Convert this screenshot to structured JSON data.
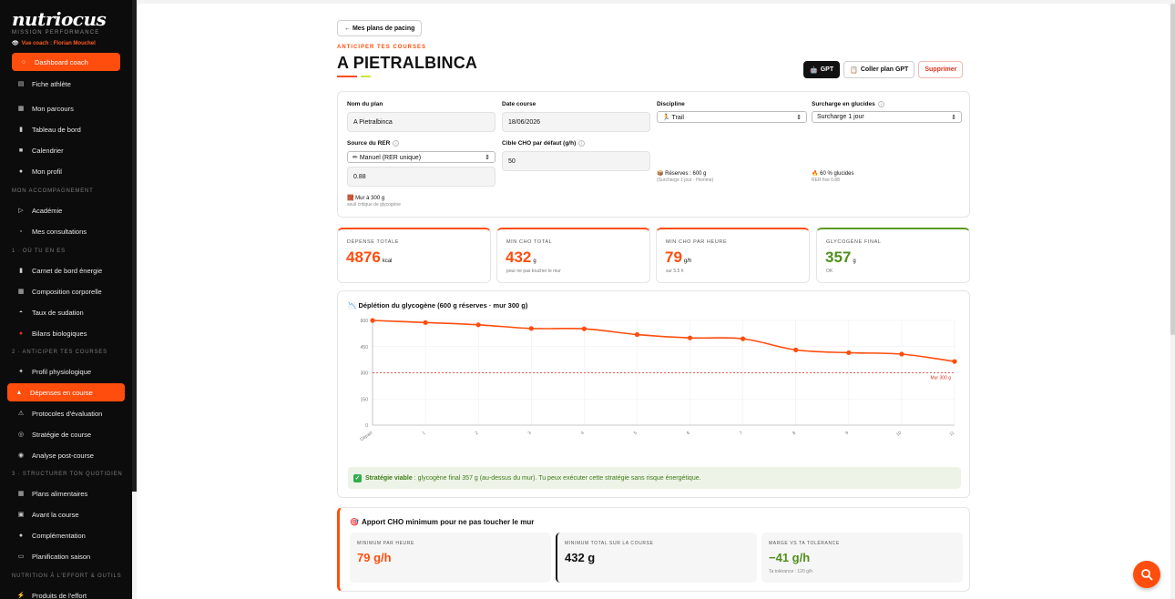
{
  "sidebar": {
    "logo": "nutriocus",
    "subtitle": "MISSION PERFORMANCE",
    "coach_line": "Vue coach : Florian Mouchel",
    "top_items": [
      {
        "label": "Dashboard coach",
        "icon": "dashboard-icon",
        "active": true
      },
      {
        "label": "Fiche athlète",
        "icon": "clipboard-icon",
        "active": false
      },
      {
        "label": "Mon parcours",
        "icon": "map-icon",
        "active": false
      },
      {
        "label": "Tableau de bord",
        "icon": "chart-icon",
        "active": false
      },
      {
        "label": "Calendrier",
        "icon": "calendar-icon",
        "active": false
      },
      {
        "label": "Mon profil",
        "icon": "user-icon",
        "active": false
      }
    ],
    "section_accompagnement": "MON ACCOMPAGNEMENT",
    "accompagnement_items": [
      {
        "label": "Académie",
        "icon": "play-icon"
      },
      {
        "label": "Mes consultations",
        "icon": "calendar-icon"
      }
    ],
    "section_1": "1 · OÙ TU EN ES",
    "section_1_items": [
      {
        "label": "Carnet de bord énergie",
        "icon": "bar-icon"
      },
      {
        "label": "Composition corporelle",
        "icon": "grid-icon"
      },
      {
        "label": "Taux de sudation",
        "icon": "drop-icon"
      },
      {
        "label": "Bilans biologiques",
        "icon": "blood-icon"
      }
    ],
    "section_2": "2 · ANTICIPER TES COURSES",
    "section_2_items": [
      {
        "label": "Profil physiologique",
        "icon": "pulse-icon",
        "active": false
      },
      {
        "label": "Dépenses en course",
        "icon": "flame-icon",
        "active": true
      },
      {
        "label": "Protocoles d'évaluation",
        "icon": "flask-icon",
        "active": false
      },
      {
        "label": "Stratégie de course",
        "icon": "target-icon",
        "active": false
      },
      {
        "label": "Analyse post-course",
        "icon": "analysis-icon",
        "active": false
      }
    ],
    "section_3": "3 · STRUCTURER TON QUOTIDIEN",
    "section_3_items": [
      {
        "label": "Plans alimentaires",
        "icon": "plate-icon"
      },
      {
        "label": "Avant la course",
        "icon": "box-icon"
      },
      {
        "label": "Complémentation",
        "icon": "pill-icon"
      },
      {
        "label": "Planification saison",
        "icon": "season-icon"
      }
    ],
    "section_4": "NUTRITION À L'EFFORT & OUTILS",
    "section_4_items": [
      {
        "label": "Produits de l'effort",
        "icon": "bolt-icon"
      }
    ]
  },
  "header": {
    "back_label": "← Mes plans de pacing",
    "eyebrow": "ANTICIPER TES COURSES",
    "title": "A PIETRALBINCA",
    "gpt_label": "GPT",
    "paste_label": "Coller plan GPT",
    "delete_label": "Supprimer"
  },
  "form": {
    "plan_name_label": "Nom du plan",
    "plan_name_value": "A Pietralbinca",
    "race_date_label": "Date course",
    "race_date_value": "18/06/2026",
    "discipline_label": "Discipline",
    "discipline_value": "Trail",
    "carb_load_label": "Surcharge en glucides",
    "carb_load_value": "Surcharge 1 jour",
    "rer_source_label": "Source du RER",
    "rer_source_value": "Manuel (RER unique)",
    "rer_value": "0.88",
    "cho_target_label": "Cible CHO par défaut (g/h)",
    "cho_target_value": "50",
    "reserves_text": "Réserves : 600 g",
    "reserves_sub": "(Surcharge 1 jour · Homme)",
    "glucides_text": "60 % glucides",
    "glucides_sub": "RER fixe 0.88",
    "wall_text": "Mur à 300 g",
    "wall_sub": "seuil critique de glycogène"
  },
  "stats": [
    {
      "label": "DÉPENSE TOTALE",
      "value": "4876",
      "unit": "kcal",
      "sub": ""
    },
    {
      "label": "MIN CHO TOTAL",
      "value": "432",
      "unit": "g",
      "sub": "pour ne pas toucher le mur"
    },
    {
      "label": "MIN CHO PAR HEURE",
      "value": "79",
      "unit": "g/h",
      "sub": "sur 5.5 h"
    },
    {
      "label": "GLYCOGÈNE FINAL",
      "value": "357",
      "unit": "g",
      "sub": "OK"
    }
  ],
  "chart": {
    "title": "Déplétion du glycogène (600 g réserves · mur 300 g)",
    "wall_label": "Mur 300 g"
  },
  "chart_data": {
    "type": "line",
    "title": "Déplétion du glycogène (600 g réserves · mur 300 g)",
    "x": [
      "Départ",
      "1",
      "2",
      "3",
      "4",
      "5",
      "6",
      "7",
      "8",
      "9",
      "10",
      "11"
    ],
    "series": [
      {
        "values": [
          600,
          588,
          575,
          554,
          552,
          519,
          500,
          495,
          431,
          415,
          407,
          365
        ]
      }
    ],
    "ylim": [
      0,
      600
    ],
    "yticks": [
      0,
      150,
      300,
      450,
      600
    ],
    "reference_line": {
      "y": 300,
      "label": "Mur 300 g",
      "color": "#e0301e"
    },
    "line_color": "#ff4d0d",
    "grid": true
  },
  "viable": {
    "strong": "Stratégie viable",
    "text": ": glycogène final 357 g (au-dessus du mur). Tu peux exécuter cette stratégie sans risque énergétique."
  },
  "cho": {
    "title": "Apport CHO minimum pour ne pas toucher le mur",
    "boxes": [
      {
        "label": "MINIMUM PAR HEURE",
        "value": "79 g/h",
        "sub": ""
      },
      {
        "label": "MINIMUM TOTAL SUR LA COURSE",
        "value": "432 g",
        "sub": ""
      },
      {
        "label": "MARGE VS TA TOLÉRANCE",
        "value": "−41 g/h",
        "sub": "Ta tolérance : 120 g/h"
      }
    ]
  },
  "colors": {
    "accent": "#ff4d0d",
    "success": "#4f8f1a",
    "danger": "#e0301e",
    "sidebar_bg": "#0c0c0c"
  }
}
